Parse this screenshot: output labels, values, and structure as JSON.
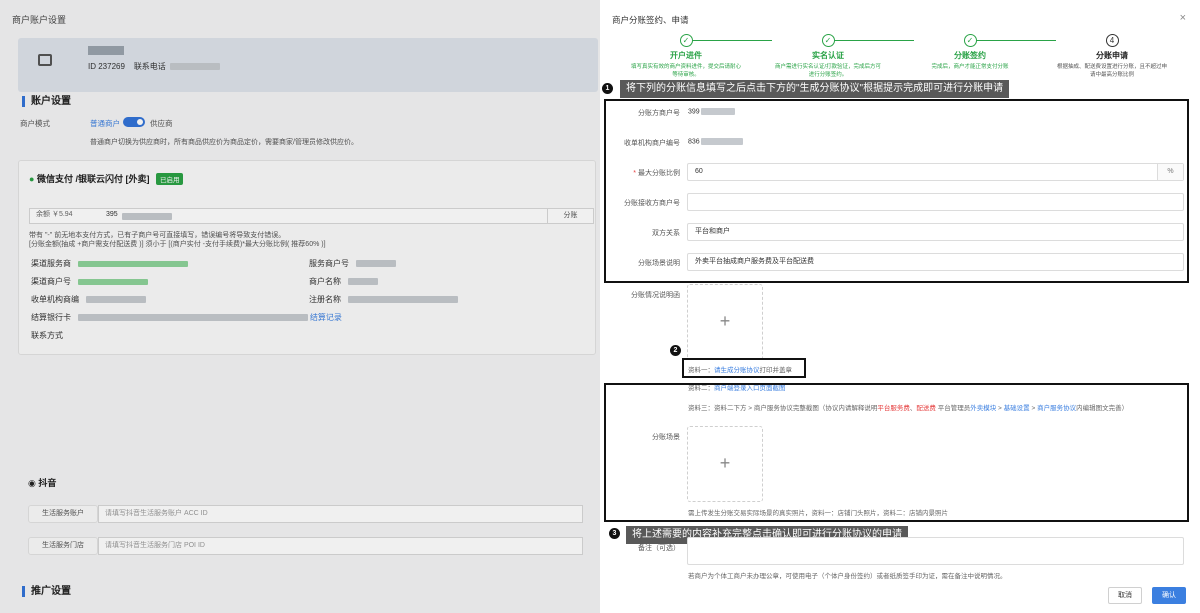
{
  "background": {
    "page_title": "商户账户设置",
    "merchant": {
      "id_text": "ID 237269",
      "phone_label": "联系电话"
    },
    "account_settings": {
      "title": "账户设置",
      "mode_label": "商户模式",
      "mode_left": "普通商户",
      "mode_right": "供应商",
      "mode_desc": "普通商户切换为供应商时，所有商品供应价为商品定价，需要商家/管理员修改供应价。"
    },
    "wechat": {
      "title": "微信支付 /银联云闪付 [外卖]",
      "badge": "已启用",
      "amount_label": "余额 ￥5.94",
      "amount_value": "395",
      "split_button": "分账",
      "tip1": "带有 \"-\" 前无地本支付方式，已有子商户号可直接填写，错误编号将导致支付错误。",
      "tip2": "[分账金额(抽成 +商户需支付配送费 )] 须小于 [(商户实付 -支付手续费)*最大分账比例( 推荐60% )]",
      "channel_service": "渠道服务商",
      "service_merchant": "服务商户号",
      "channel_merchant": "渠道商户号",
      "merchant_name": "商户名称",
      "acquirer": "收单机构商编",
      "reg_name": "注册名称",
      "bank_card": "结算银行卡",
      "settle_record": "结算记录",
      "contact": "联系方式"
    },
    "douyin": {
      "title": "抖音",
      "service_account_label": "生活服务账户",
      "service_account_placeholder": "请填写抖音生活服务账户 ACC ID",
      "service_store_label": "生活服务门店",
      "service_store_placeholder": "请填写抖音生活服务门店 POI ID"
    },
    "promo": {
      "title": "推广设置"
    }
  },
  "drawer": {
    "title": "商户分账签约、申请",
    "close_icon": "×",
    "steps": [
      {
        "label": "开户进件",
        "desc": "填写真实有效的商户资料进件，提交后请耐心等待审核。",
        "icon": "✓"
      },
      {
        "label": "实名认证",
        "desc": "商户需进行实名认证/打款验证，完成后方可进行分账签约。",
        "icon": "✓"
      },
      {
        "label": "分账签约",
        "desc": "完成后，商户才能正常支付分账",
        "icon": "✓"
      },
      {
        "label": "分账申请",
        "desc": "根据抽成、配送费设置进行分账，且不超过申请中最高分账比例",
        "icon": "4"
      }
    ],
    "callouts": {
      "c1": "将下列的分账信息填写之后点击下方的\"生成分账协议\"根据提示完成即可进行分账申请",
      "c3": "将上述需要的内容补充完整点击确认即可进行分账协议的申请"
    },
    "form": {
      "split_merchant_label": "分账方商户号",
      "split_merchant_value": "399",
      "acquirer_label": "收单机构商户编号",
      "acquirer_value": "836",
      "max_ratio_label": "最大分账比例",
      "max_ratio_value": "60",
      "max_ratio_suffix": "%",
      "receiver_label": "分账接收方商户号",
      "receiver_value": "",
      "relation_label": "双方关系",
      "relation_value": "平台和商户",
      "scene_desc_label": "分账场景说明",
      "scene_desc_value": "外卖平台抽成商户服务费及平台配送费",
      "letter_label": "分账情况说明函",
      "upload_icon": "+",
      "material1_prefix": "资料一：",
      "material1_link": "请生成分账协议",
      "material1_suffix": "打印并盖章",
      "material2_prefix": "资料二：",
      "material2_link": "商户端登录入口页面截图",
      "material3_prefix": "资料三：资料二下方 > 商户服务协议完整截图（协议内请解释说明",
      "material3_red1": "平台服务费",
      "material3_sep": "、",
      "material3_red2": "配送费",
      "material3_mid": " 平台管理员",
      "material3_link1": "外卖模块",
      "material3_gt1": " > ",
      "material3_link2": "基础设置",
      "material3_gt2": " > ",
      "material3_link3": "商户服务协议",
      "material3_end": "内编辑图文完善）",
      "scene_label": "分账场景",
      "scene_note": "需上传发生分账交易实际场景的真实照片，资料一：店铺门头照片，资料二：店铺内景照片",
      "remark_label": "备注（可选）",
      "remark_note": "若商户为个体工商户未办理公章，可使用电子（个体户身份签约）或者纸质签手印为证，需在备注中说明情况。",
      "cancel_button": "取消",
      "ok_button": "确认"
    },
    "markers": [
      "1",
      "2",
      "3"
    ]
  }
}
